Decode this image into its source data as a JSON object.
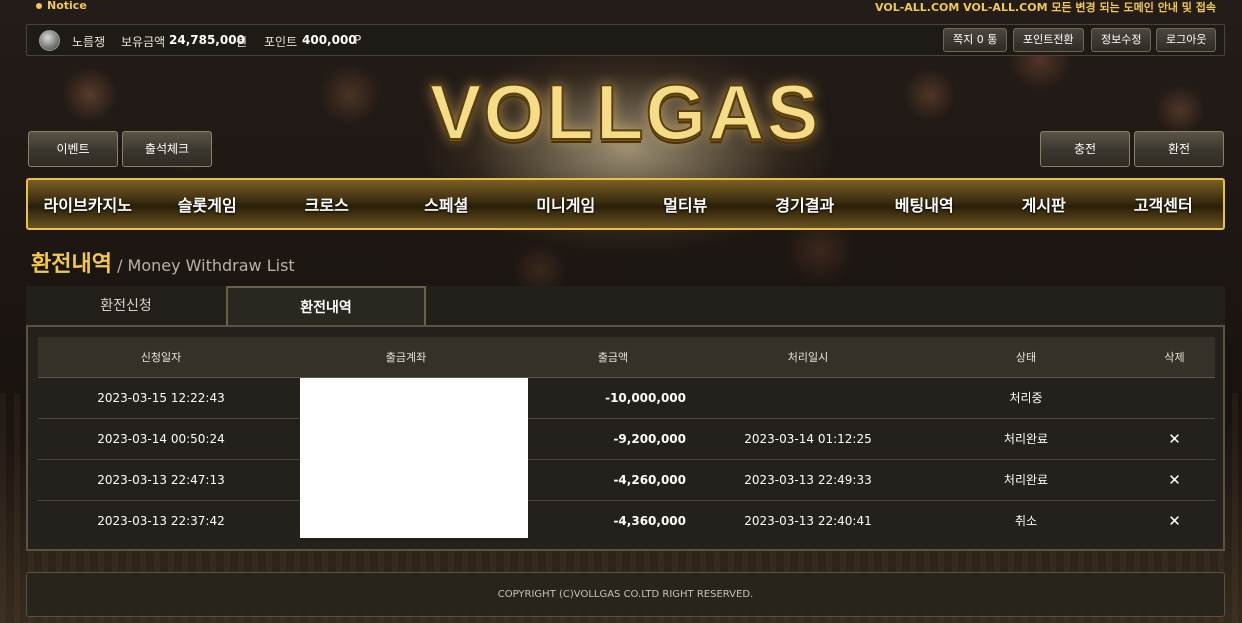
{
  "notice": {
    "label": "Notice",
    "text": "VOL-ALL.COM VOL-ALL.COM 모든 변경 되는 도메인 안내 및 접속"
  },
  "userbar": {
    "username": "노름쟁",
    "balance_label": "보유금액",
    "balance_value": "24,785,000",
    "balance_unit": "원",
    "points_label": "포인트",
    "points_value": "400,000",
    "points_unit": "P",
    "buttons": {
      "messages": "쪽지 0 통",
      "point_convert": "포인트전환",
      "edit_info": "정보수정",
      "logout": "로그아웃"
    }
  },
  "logo": "VOLLGAS",
  "side_buttons": {
    "event": "이벤트",
    "attendance": "출석체크",
    "deposit": "충전",
    "withdraw": "환전"
  },
  "nav": [
    "라이브카지노",
    "슬롯게임",
    "크로스",
    "스페셜",
    "미니게임",
    "멀티뷰",
    "경기결과",
    "베팅내역",
    "게시판",
    "고객센터"
  ],
  "page": {
    "title_ko": "환전내역",
    "title_en": "/ Money Withdraw List"
  },
  "tabs": [
    {
      "label": "환전신청",
      "active": false
    },
    {
      "label": "환전내역",
      "active": true
    }
  ],
  "table": {
    "headers": [
      "신청일자",
      "출금계좌",
      "출금액",
      "처리일시",
      "상태",
      "삭제"
    ],
    "rows": [
      {
        "date": "2023-03-15 12:22:43",
        "account": "",
        "amount": "-10,000,000",
        "processed": "",
        "status": "처리중",
        "delete": ""
      },
      {
        "date": "2023-03-14 00:50:24",
        "account": "",
        "amount": "-9,200,000",
        "processed": "2023-03-14 01:12:25",
        "status": "처리완료",
        "delete": "✕"
      },
      {
        "date": "2023-03-13 22:47:13",
        "account": "",
        "amount": "-4,260,000",
        "processed": "2023-03-13 22:49:33",
        "status": "처리완료",
        "delete": "✕"
      },
      {
        "date": "2023-03-13 22:37:42",
        "account": "",
        "amount": "-4,360,000",
        "processed": "2023-03-13 22:40:41",
        "status": "취소",
        "delete": "✕"
      }
    ]
  },
  "footer": "COPYRIGHT (C)VOLLGAS CO.LTD RIGHT RESERVED.",
  "colors": {
    "accent_gold": "#f2c94c",
    "nav_border": "#e7c24a"
  }
}
